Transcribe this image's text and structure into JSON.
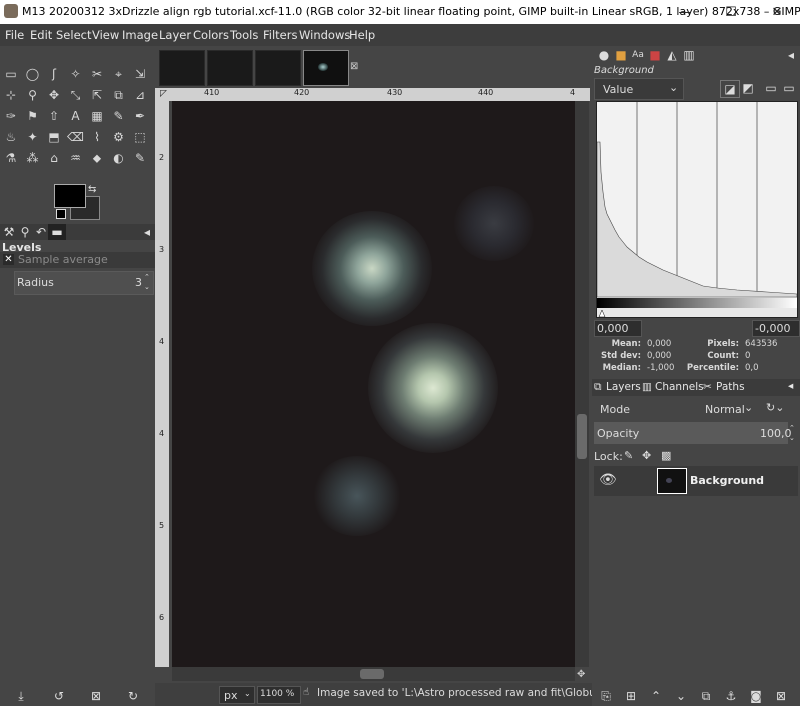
{
  "window": {
    "title": "M13 20200312 3xDrizzle align rgb tutorial.xcf-11.0 (RGB color 32-bit linear floating point, GIMP built-in Linear sRGB, 1 layer) 872x738 – GIMP",
    "minimize": "—",
    "maximize": "☐",
    "close": "✕"
  },
  "menu": [
    "File",
    "Edit",
    "Select",
    "View",
    "Image",
    "Layer",
    "Colors",
    "Tools",
    "Filters",
    "Windows",
    "Help"
  ],
  "toolbox": {
    "tools": [
      "▭",
      "◯",
      "ʃ",
      "✧",
      "✂",
      "⌖",
      "⇲",
      "⊹",
      "⚲",
      "✥",
      "⤡",
      "⇱",
      "⧉",
      "⊿",
      "✑",
      "⚑",
      "⇧",
      "A",
      "▦",
      "✎",
      "✒",
      "♨",
      "✦",
      "⬒",
      "⌫",
      "⌇",
      "⚙",
      "⬚",
      "⚗",
      "⁂",
      "⌂",
      "♒",
      "⬥",
      "◐",
      "✎"
    ],
    "fg_color": "#000000",
    "bg_color": "#2a2a2a"
  },
  "tool_options": {
    "title": "Levels",
    "sample_label": "Sample average",
    "radius_label": "Radius",
    "radius_value": "3"
  },
  "rulers": {
    "top_ticks": [
      "410",
      "420",
      "430",
      "440",
      "4"
    ],
    "left_ticks": [
      "2",
      "3",
      "4",
      "4",
      "5",
      "6"
    ]
  },
  "status": {
    "unit": "px",
    "zoom": "1100 %",
    "message": "Image saved to 'L:\\Astro processed raw and fit\\Globular St..."
  },
  "histogram": {
    "channel_title": "Background",
    "channel": "Value",
    "range_low": "0,000",
    "range_high": "-0,000",
    "mean_label": "Mean:",
    "mean": "0,000",
    "stddev_label": "Std dev:",
    "stddev": "0,000",
    "median_label": "Median:",
    "median": "-1,000",
    "pixels_label": "Pixels:",
    "pixels": "643536",
    "count_label": "Count:",
    "count": "0",
    "percentile_label": "Percentile:",
    "percentile": "0,0"
  },
  "layers": {
    "tabs": [
      "Layers",
      "Channels",
      "Paths"
    ],
    "mode_label": "Mode",
    "mode_value": "Normal",
    "opacity_label": "Opacity",
    "opacity_value": "100,0",
    "lock_label": "Lock:",
    "layer_name": "Background"
  }
}
